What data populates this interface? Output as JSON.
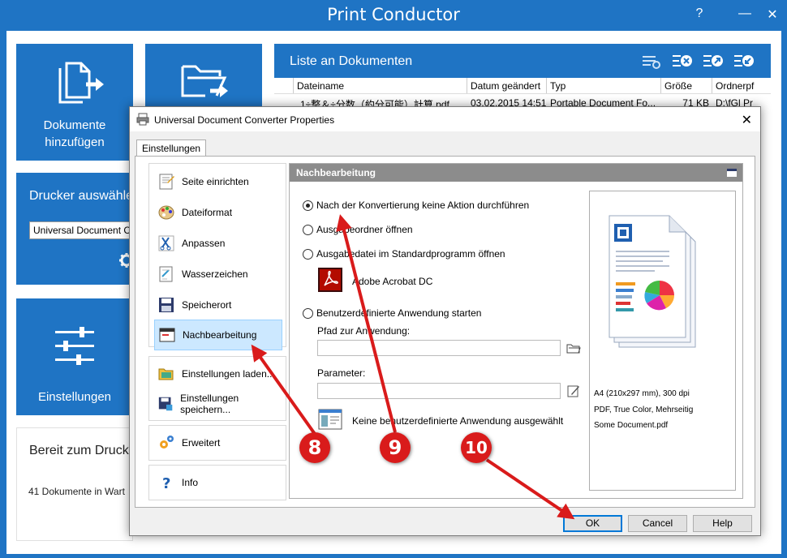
{
  "app": {
    "title": "Print Conductor",
    "help_glyph": "?",
    "minimize_glyph": "—",
    "close_glyph": "✕"
  },
  "tiles": {
    "add_documents": "Dokumente hinzufügen",
    "settings": "Einstellungen"
  },
  "printer": {
    "label": "Drucker auswähle",
    "selected": "Universal Document C"
  },
  "status": {
    "title": "Bereit zum Druck",
    "count": "41 Dokumente in Wart"
  },
  "doc_list": {
    "title": "Liste an Dokumenten",
    "columns": [
      "Dateiname",
      "Datum geändert",
      "Typ",
      "Größe",
      "Ordnerpf"
    ],
    "rows": [
      [
        "1÷整＆÷分数（約分可能）計算.pdf",
        "03.02.2015 14:51",
        "Portable Document Fo...",
        "71 KB",
        "D:\\fGl Pr"
      ]
    ]
  },
  "dialog": {
    "title": "Universal Document Converter Properties",
    "close_glyph": "✕",
    "tab": "Einstellungen",
    "nav": {
      "page_setup": "Seite einrichten",
      "file_format": "Dateiformat",
      "adjust": "Anpassen",
      "watermark": "Wasserzeichen",
      "location": "Speicherort",
      "post_processing": "Nachbearbeitung",
      "load_settings": "Einstellungen laden...",
      "save_settings": "Einstellungen speichern...",
      "advanced": "Erweitert",
      "info": "Info"
    },
    "section_title": "Nachbearbeitung",
    "options": {
      "no_action": "Nach der Konvertierung keine Aktion durchführen",
      "open_folder": "Ausgabeordner öffnen",
      "open_file": "Ausgabedatei im Standardprogramm öffnen",
      "default_app": "Adobe Acrobat DC",
      "custom_app": "Benutzerdefinierte Anwendung starten"
    },
    "fields": {
      "path_label": "Pfad zur Anwendung:",
      "path_value": "",
      "params_label": "Parameter:",
      "params_value": "",
      "no_app_selected": "Keine benutzerdefinierte Anwendung ausgewählt"
    },
    "preview": {
      "line1": "A4 (210x297 mm), 300 dpi",
      "line2": "PDF, True Color, Mehrseitig",
      "line3": "Some Document.pdf"
    },
    "buttons": {
      "ok": "OK",
      "cancel": "Cancel",
      "help": "Help"
    }
  },
  "markers": [
    "8",
    "9",
    "10"
  ],
  "colors": {
    "accent": "#1f74c4",
    "annotation": "#d91b1b",
    "selection": "#cce8ff"
  }
}
